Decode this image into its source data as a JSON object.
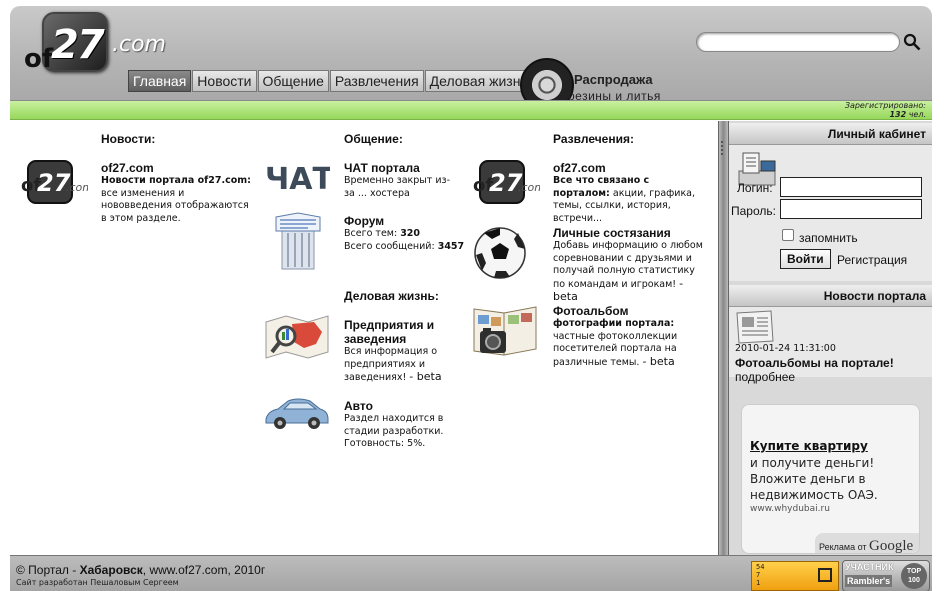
{
  "header": {
    "logo": {
      "prefix": "of",
      "number": "27",
      "suffix": ".com"
    },
    "search": {
      "value": ""
    },
    "nav": [
      {
        "label": "Главная",
        "active": true
      },
      {
        "label": "Новости"
      },
      {
        "label": "Общение"
      },
      {
        "label": "Развлечения"
      },
      {
        "label": "Деловая жизнь"
      }
    ],
    "promo": {
      "line1": "Распродажа",
      "line2": "резины и литья"
    },
    "registered": {
      "label": "Зарегистрировано:",
      "count": "132",
      "unit": "чел."
    }
  },
  "sections": {
    "news": {
      "title": "Новости:",
      "items": [
        {
          "title": "of27.com",
          "desc_bold": "Новости портала of27.com:",
          "desc": "все изменения и нововведения отображаются в этом разделе.",
          "icon": "of27-logo-icon"
        }
      ]
    },
    "social": {
      "title": "Общение:",
      "items": [
        {
          "title": "ЧАТ портала",
          "desc": "Временно закрыт из-за ... хостера",
          "icon": "chat-icon",
          "icon_text": "ЧАТ"
        },
        {
          "title": "Форум",
          "stats": [
            {
              "label": "Всего тем:",
              "value": "320"
            },
            {
              "label": "Всего сообщений:",
              "value": "3457"
            }
          ],
          "icon": "forum-icon"
        }
      ]
    },
    "business": {
      "title": "Деловая жизнь:",
      "items": [
        {
          "title": "Предприятия и заведения",
          "desc": "Вся информация о предприятиях и заведениях!",
          "beta": "- beta",
          "icon": "map-icon"
        },
        {
          "title": "Авто",
          "desc": "Раздел находится в стадии разработки. Готовность: 5%.",
          "icon": "car-icon"
        }
      ]
    },
    "entertainment": {
      "title": "Развлечения:",
      "items": [
        {
          "title": "of27.com",
          "desc_bold": "Все что связано с порталом:",
          "desc": "акции, графика, темы, ссылки, история, встречи...",
          "icon": "of27-logo-icon"
        },
        {
          "title": "Личные состязания",
          "desc": "Добавь информацию о любом соревновании с друзьями и получай полную статистику по командам и игрокам!",
          "beta": "- beta",
          "icon": "soccer-ball-icon"
        },
        {
          "title": "Фотоальбом",
          "desc_bold": "фотографии портала:",
          "desc": "частные фотоколлекции посетителей портала на различные темы.",
          "beta": "- beta",
          "icon": "photo-album-icon"
        }
      ]
    }
  },
  "sidebar": {
    "cabinet": {
      "title": "Личный кабинет",
      "login_label": "Логин:",
      "password_label": "Пароль:",
      "login_value": "",
      "password_value": "",
      "remember_label": "запомнить",
      "remember_checked": false,
      "login_button": "Войти",
      "register_link": "Регистрация"
    },
    "portal_news": {
      "title": "Новости портала",
      "date": "2010-01-24 11:31:00",
      "headline": "Фотоальбомы на портале!",
      "more": "подробнее"
    },
    "ad": {
      "title": "Купите квартиру",
      "text": "и получите деньги! Вложите деньги в недвижимость ОАЭ.",
      "url": "www.whydubai.ru",
      "ads_by": "Реклама от",
      "google": "Google"
    }
  },
  "footer": {
    "copyright_prefix": "© Портал - ",
    "city": "Хабаровск",
    "copyright_suffix": ", www.of27.com, 2010г",
    "developer": "Сайт разработан Пешаловым Сергеем",
    "counter1": {
      "lines": [
        "54",
        "7",
        "1"
      ]
    },
    "counter2": {
      "line1": "УЧАСТНИК",
      "line2": "Rambler's",
      "badge": "TOP 100"
    }
  },
  "colors": {
    "green_bar": "#96d85a",
    "active_tab": "#5e5e5e",
    "header": "#b4b4b4"
  }
}
